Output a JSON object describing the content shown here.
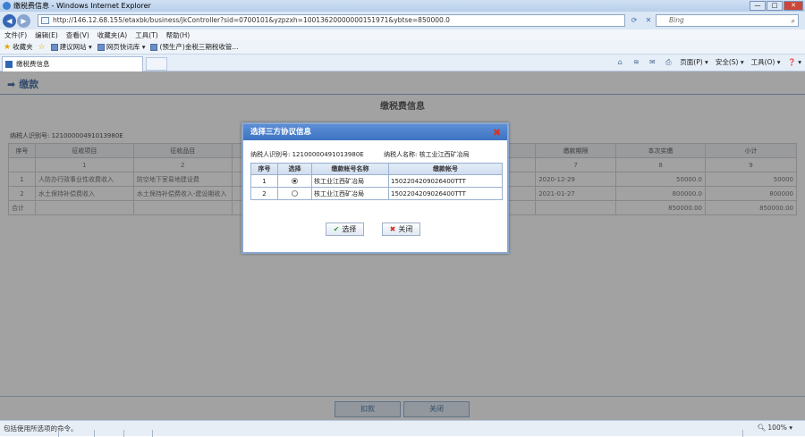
{
  "window": {
    "title": "缴税费信息 - Windows Internet Explorer"
  },
  "address": {
    "url": "http://146.12.68.155/etaxbk/business/jkController?sid=0700101&yzpzxh=10013620000000151971&ybtse=850000.0"
  },
  "search": {
    "placeholder": "Bing"
  },
  "menu": [
    "文件(F)",
    "编辑(E)",
    "查看(V)",
    "收藏夹(A)",
    "工具(T)",
    "帮助(H)"
  ],
  "favorites": {
    "label": "收藏夹",
    "links": [
      "建议网站 ▾",
      "网页快讯库 ▾",
      "(预生产)金税三期税收管..."
    ]
  },
  "tab": {
    "label": "缴税费信息"
  },
  "commandbar": {
    "page": "页面(P) ▾",
    "safety": "安全(S) ▾",
    "tools": "工具(O) ▾",
    "help": "❓ ▾"
  },
  "page": {
    "title": "缴款",
    "section_title": "缴税费信息",
    "taxpayer_id_label": "纳税人识别号: 12100000491013980E",
    "table": {
      "headers": [
        "序号",
        "征收项目",
        "征收品目",
        "",
        "",
        "",
        "",
        "缴款期限",
        "本次实缴",
        "小计"
      ],
      "index_row": [
        "",
        "1",
        "2",
        "",
        "",
        "",
        "",
        "7",
        "8",
        "9"
      ],
      "rows": [
        [
          "1",
          "人防办行政事业性收费收入",
          "防空地下室易地建设费",
          "",
          "",
          "",
          "",
          "2020-12-29",
          "50000.0",
          "50000"
        ],
        [
          "2",
          "水土保持补偿费收入",
          "水土保持补偿费收入-建设期收入",
          "",
          "",
          "",
          "",
          "2021-01-27",
          "800000.0",
          "800000"
        ]
      ],
      "total_label": "合计",
      "total_paid": "850000.00",
      "total_sum": "850000.00"
    },
    "buttons": {
      "pay": "扣款",
      "close": "关闭"
    }
  },
  "dialog": {
    "title": "选择三方协议信息",
    "taxpayer_id": "纳税人识别号: 12100000491013980E",
    "taxpayer_name": "纳税人名称: 核工业江西矿冶局",
    "headers": [
      "序号",
      "选择",
      "缴款帐号名称",
      "缴款帐号"
    ],
    "rows": [
      {
        "no": "1",
        "selected": true,
        "name": "核工业江西矿冶局",
        "account": "1502204209026400TTT"
      },
      {
        "no": "2",
        "selected": false,
        "name": "核工业江西矿冶局",
        "account": "1502204209026400TTT"
      }
    ],
    "select_button": "选择",
    "close_button": "关闭"
  },
  "status": {
    "text": "包括使用所选项的命令。",
    "zoom": "100% ▾"
  }
}
